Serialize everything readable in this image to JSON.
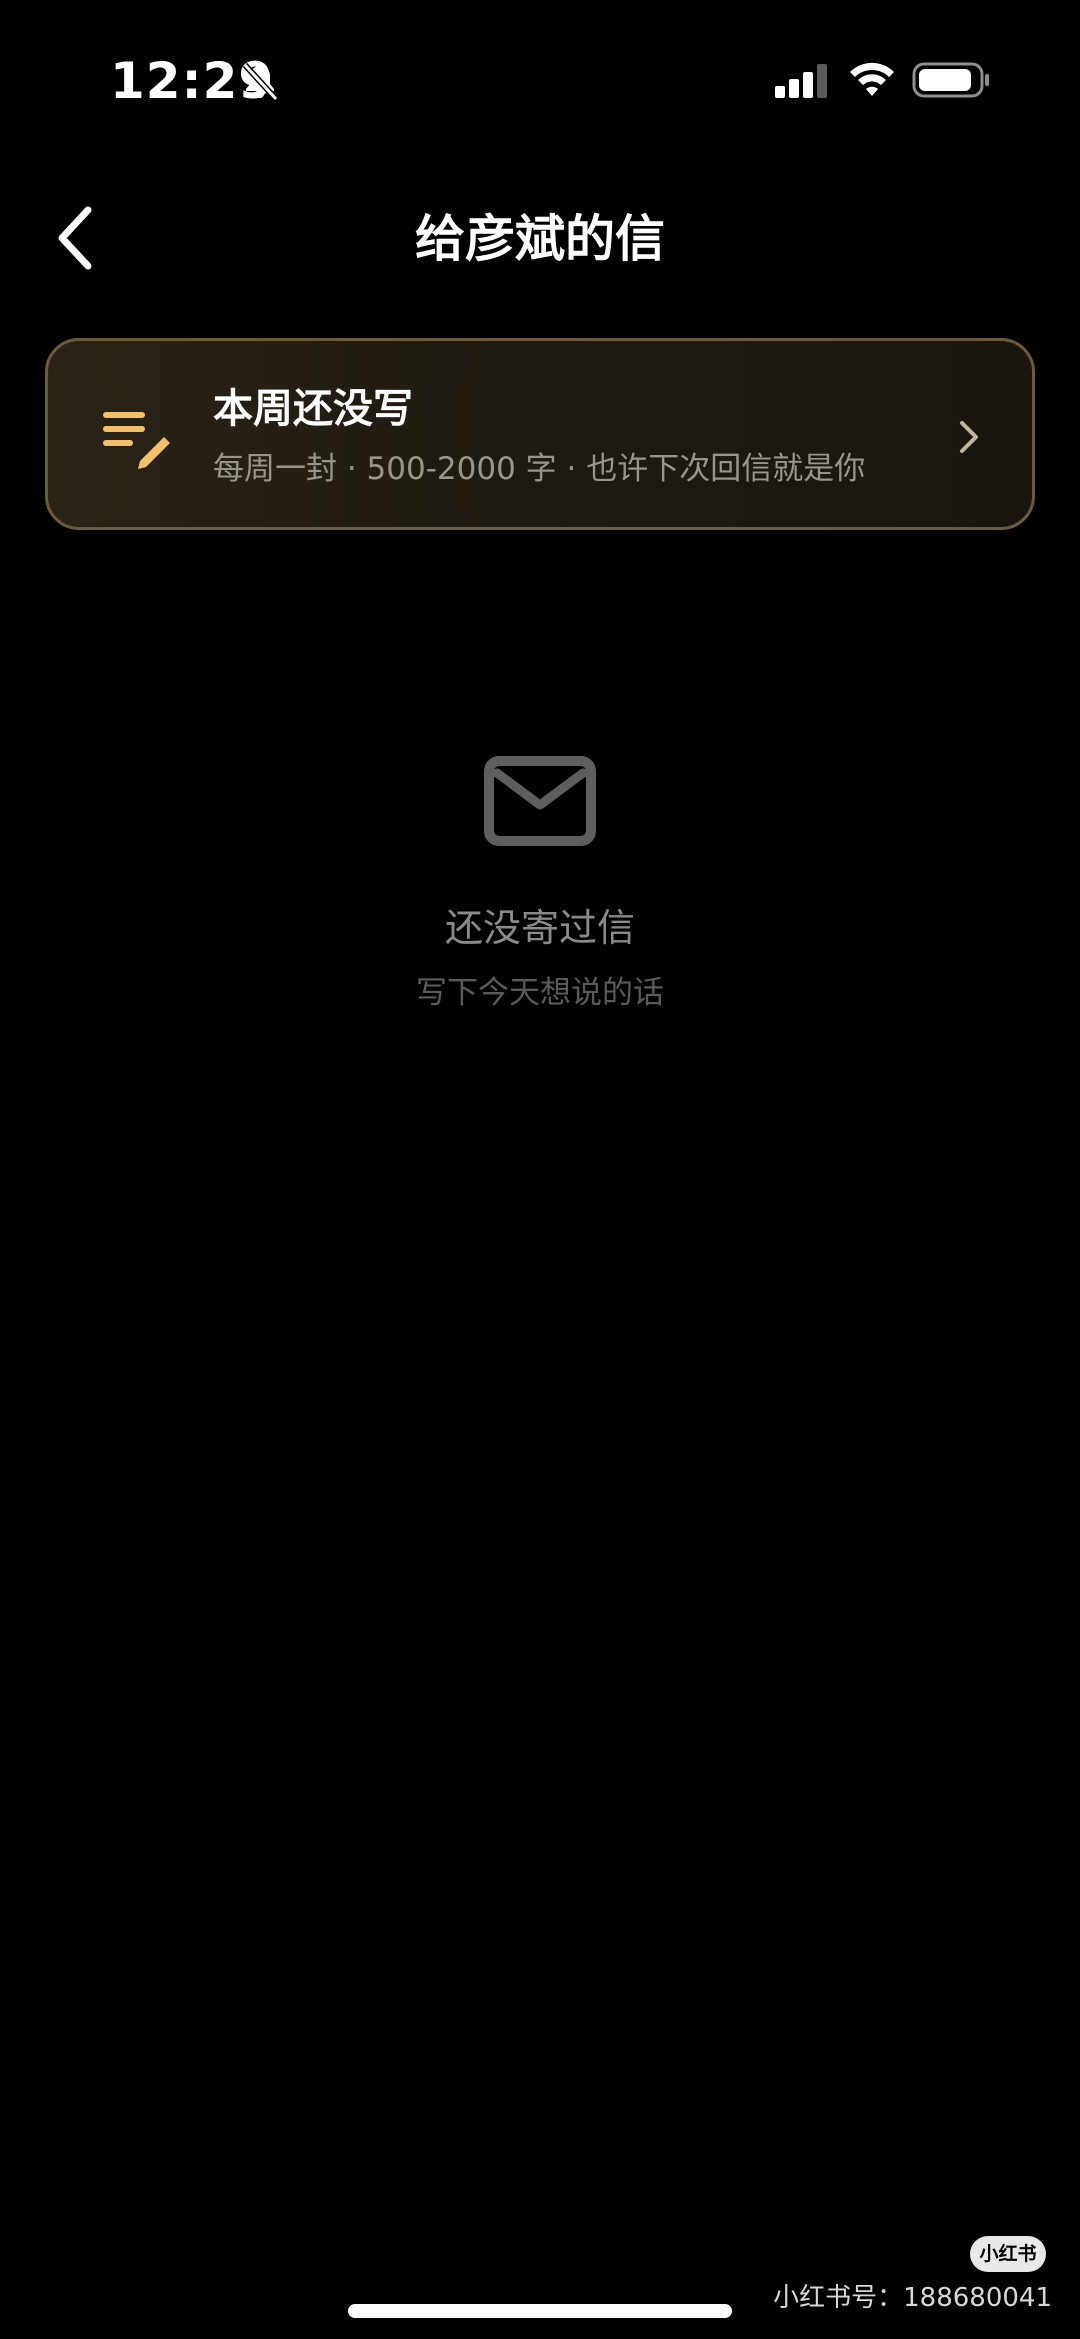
{
  "status_bar": {
    "time": "12:29",
    "icons": [
      "bell-off-icon",
      "signal-icon",
      "wifi-icon",
      "battery-icon"
    ]
  },
  "nav": {
    "back_icon": "chevron-left-icon",
    "title": "给彦斌的信"
  },
  "prompt_card": {
    "icon": "write-list-pencil-icon",
    "title": "本周还没写",
    "subtitle": "每周一封 · 500-2000 字 · 也许下次回信就是你",
    "chevron_icon": "chevron-right-icon",
    "accent_color": "#f2c06a",
    "border_color": "#6b5a3c"
  },
  "empty_state": {
    "icon": "envelope-icon",
    "title": "还没寄过信",
    "subtitle": "写下今天想说的话"
  },
  "watermark": {
    "logo_text": "小红书",
    "id_text": "小红书号：188680041"
  }
}
